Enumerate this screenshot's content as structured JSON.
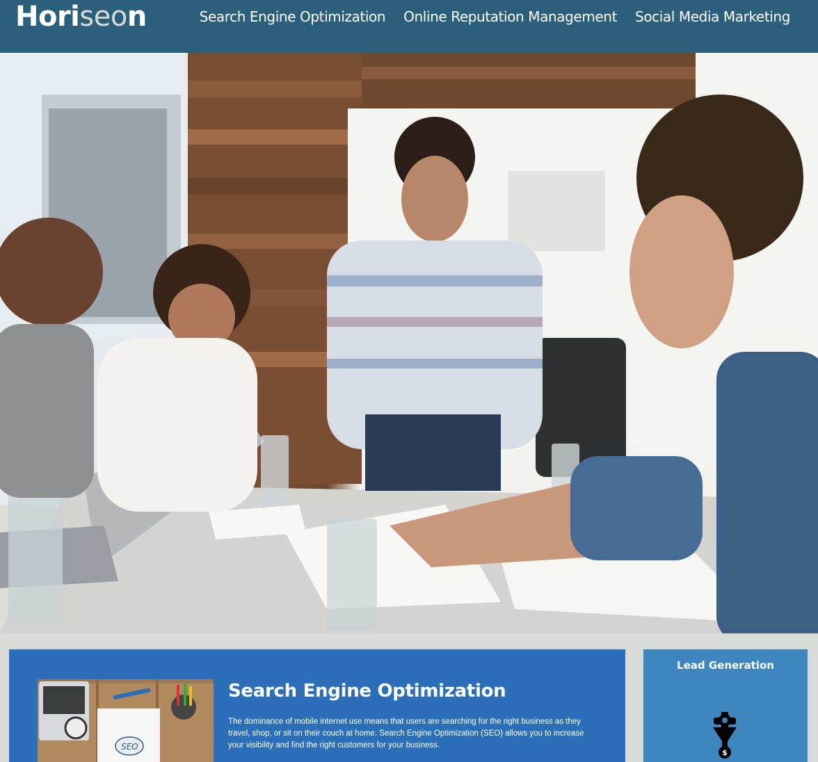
{
  "header": {
    "logo_main": "Hori",
    "logo_accent": "seo",
    "logo_end": "n",
    "nav": [
      "Search Engine Optimization",
      "Online Reputation Management",
      "Social Media Marketing"
    ]
  },
  "content": {
    "seo": {
      "title": "Search Engine Optimization",
      "body": "The dominance of mobile internet use means that users are searching for the right business as they travel, shop, or sit on their couch at home. Search Engine Optimization (SEO) allows you to increase your visibility and find the right customers for your business."
    }
  },
  "benefits": {
    "lead": {
      "title": "Lead Generation",
      "icon": "lead-generation-icon"
    }
  },
  "colors": {
    "header_bg": "#2a607c",
    "seo_card": "#2a6fb8",
    "lead_card": "#3d86bf",
    "page_bg": "#d9dcd6"
  }
}
